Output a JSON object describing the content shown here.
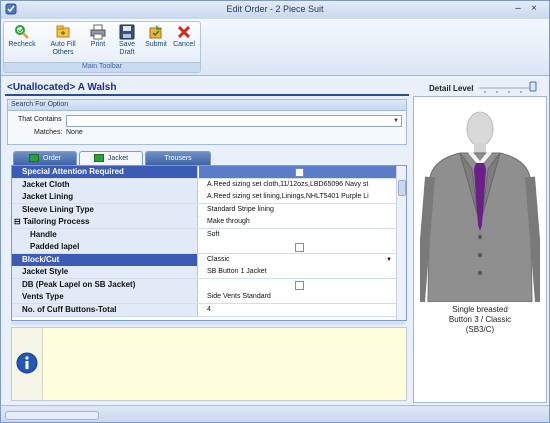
{
  "window": {
    "title": "Edit Order - 2 Piece Suit"
  },
  "toolbar": {
    "group_label": "Main Toolbar",
    "buttons": [
      {
        "label": "Recheck",
        "icon": "recheck-icon"
      },
      {
        "label": "Auto Fill Others",
        "icon": "auto-fill-icon"
      },
      {
        "label": "Print",
        "icon": "printer-icon"
      },
      {
        "label": "Save Draft",
        "icon": "floppy-disk-icon"
      },
      {
        "label": "Submit",
        "icon": "submit-icon"
      },
      {
        "label": "Cancel",
        "icon": "cancel-x-icon"
      }
    ]
  },
  "header": {
    "customer": "<Unallocated> A Walsh",
    "detail_level_label": "Detail Level"
  },
  "search": {
    "title": "Search For Option",
    "contains_label": "That Contains",
    "contains_value": "",
    "matches_label": "Matches:",
    "matches_value": "None"
  },
  "tabs": [
    "Order",
    "Jacket",
    "Trousers"
  ],
  "active_tab": "Jacket",
  "grid": {
    "rows": [
      {
        "label": "Special Attention Required",
        "value": "",
        "type": "checkbox",
        "indent": 0,
        "state": "highlight"
      },
      {
        "label": "Jacket Cloth",
        "value": "A.Reed sizing set cloth,11/12ozs,LBD65096 Navy st",
        "type": "text",
        "indent": 0,
        "state": ""
      },
      {
        "label": "Jacket Lining",
        "value": "A.Reed sizing set lining,Linings,NHLT5401 Purple Li",
        "type": "text",
        "indent": 0,
        "state": ""
      },
      {
        "label": "Sleeve Lining Type",
        "value": "Standard Stripe lining",
        "type": "text",
        "indent": 0,
        "state": ""
      },
      {
        "label": "Tailoring Process",
        "value": "Make through",
        "type": "text",
        "indent": 0,
        "state": "",
        "expander": "⊟"
      },
      {
        "label": "Handle",
        "value": "Soft",
        "type": "text",
        "indent": 1,
        "state": ""
      },
      {
        "label": "Padded lapel",
        "value": "",
        "type": "checkbox",
        "indent": 1,
        "state": ""
      },
      {
        "label": "Block/Cut",
        "value": "Classic",
        "type": "dropdown",
        "indent": 0,
        "state": "selected"
      },
      {
        "label": "Jacket Style",
        "value": "SB Button 1 Jacket",
        "type": "text",
        "indent": 0,
        "state": ""
      },
      {
        "label": "DB (Peak Lapel on SB Jacket)",
        "value": "",
        "type": "checkbox",
        "indent": 0,
        "state": ""
      },
      {
        "label": "Vents Type",
        "value": "Side Vents Standard",
        "type": "text",
        "indent": 0,
        "state": ""
      },
      {
        "label": "No. of Cuff Buttons-Total",
        "value": "4",
        "type": "text",
        "indent": 0,
        "state": ""
      }
    ]
  },
  "preview": {
    "caption": [
      "Single breasted",
      "Button 3  / Classic",
      "(SB3/C)"
    ]
  },
  "colors": {
    "selected": "#3b5bb5",
    "tab_active_bg": "#f4f8fc",
    "tab_inactive": "#4a6fb0",
    "info_bg": "#ffffdc",
    "tie": "#6c1e8a"
  }
}
